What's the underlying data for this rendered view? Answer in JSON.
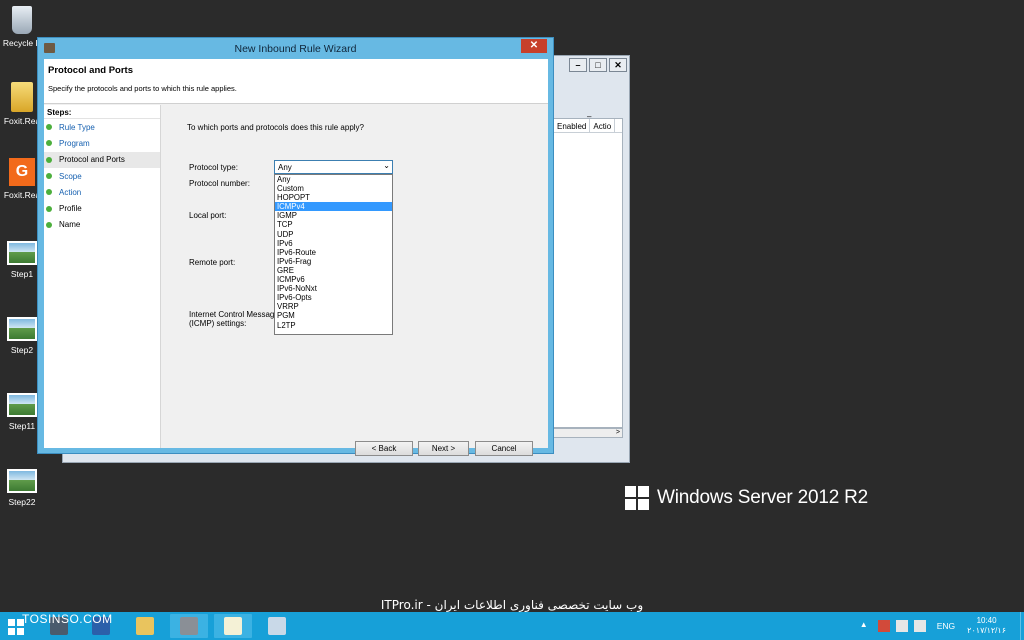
{
  "desktop": {
    "icons": [
      {
        "label": "Recycle B",
        "icon": "recycle-bin-icon"
      },
      {
        "label": "Foxit.Rea",
        "icon": "folder-icon"
      },
      {
        "label": "Foxit.Rea",
        "icon": "foxit-pdf-icon"
      },
      {
        "label": "Step1",
        "icon": "image-thumbnail-icon"
      },
      {
        "label": "Step2",
        "icon": "image-thumbnail-icon"
      },
      {
        "label": "Step11",
        "icon": "image-thumbnail-icon"
      },
      {
        "label": "Step22",
        "icon": "image-thumbnail-icon"
      }
    ]
  },
  "background_window": {
    "columns": [
      "Enabled",
      "Actio"
    ],
    "header_mark": "–",
    "scroll_right": ">"
  },
  "wizard": {
    "title": "New Inbound Rule Wizard",
    "close_glyph": "✕",
    "header_title": "Protocol and Ports",
    "header_desc": "Specify the protocols and ports to which this rule applies.",
    "steps_title": "Steps:",
    "steps": [
      {
        "label": "Rule Type",
        "link": true
      },
      {
        "label": "Program",
        "link": true
      },
      {
        "label": "Protocol and Ports",
        "link": false,
        "current": true
      },
      {
        "label": "Scope",
        "link": true
      },
      {
        "label": "Action",
        "link": true
      },
      {
        "label": "Profile",
        "link": false
      },
      {
        "label": "Name",
        "link": false
      }
    ],
    "question": "To which ports and protocols does this rule apply?",
    "protocol_type_label": "Protocol type:",
    "protocol_number_label": "Protocol number:",
    "local_port_label": "Local port:",
    "remote_port_label": "Remote port:",
    "icmp_label_1": "Internet Control Message",
    "icmp_label_2": "(ICMP) settings:",
    "protocol_selected": "Any",
    "protocol_options": [
      "Any",
      "Custom",
      "HOPOPT",
      "ICMPv4",
      "IGMP",
      "TCP",
      "UDP",
      "IPv6",
      "IPv6-Route",
      "IPv6-Frag",
      "GRE",
      "ICMPv6",
      "IPv6-NoNxt",
      "IPv6-Opts",
      "VRRP",
      "PGM",
      "L2TP"
    ],
    "highlighted_option": "ICMPv4",
    "back_label": "< Back",
    "next_label": "Next >",
    "cancel_label": "Cancel"
  },
  "branding": {
    "os_name": "Windows Server 2012 R2",
    "watermark_left": "TOSINSO.COM",
    "watermark_center": "ITPro.ir - وب سایت تخصصی فناوری اطلاعات ایران"
  },
  "taskbar": {
    "apps": [
      "server-manager-icon",
      "powershell-icon",
      "file-explorer-icon",
      "settings-icon",
      "notepad-icon",
      "paint-icon"
    ],
    "language": "ENG",
    "time": "10:40",
    "date": "۲۰۱۷/۱۲/۱۶"
  },
  "colors": {
    "wizard_frame": "#67b9e3",
    "taskbar": "#17a0d8",
    "selection": "#3399ff",
    "close_button": "#c7402b",
    "link": "#1660b0"
  }
}
